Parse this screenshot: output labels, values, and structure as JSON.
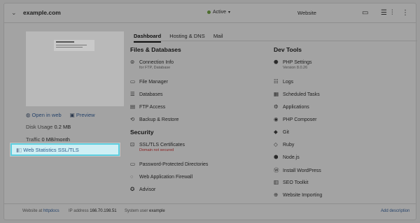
{
  "header": {
    "domain": "example.com",
    "status": "Active",
    "type": "Website"
  },
  "preview": {
    "open_in_web": "Open in web",
    "preview": "Preview",
    "disk_usage_label": "Disk Usage",
    "disk_usage_value": "0.2 MB",
    "traffic_label": "Traffic",
    "traffic_value": "0 MB/month",
    "web_statistics": "Web Statistics SSL/TLS"
  },
  "tabs": [
    "Dashboard",
    "Hosting & DNS",
    "Mail"
  ],
  "files_databases": {
    "title": "Files & Databases",
    "connection_info": "Connection Info",
    "connection_sub": "for FTP, Database",
    "file_manager": "File Manager",
    "databases": "Databases",
    "ftp_access": "FTP Access",
    "backup_restore": "Backup & Restore"
  },
  "security": {
    "title": "Security",
    "ssl": "SSL/TLS Certificates",
    "ssl_sub": "Domain not secured",
    "password_dirs": "Password-Protected Directories",
    "waf": "Web Application Firewall",
    "advisor": "Advisor"
  },
  "dev_tools": {
    "title": "Dev Tools",
    "php_settings": "PHP Settings",
    "php_version": "Version 8.0.26",
    "logs": "Logs",
    "scheduled_tasks": "Scheduled Tasks",
    "applications": "Applications",
    "php_composer": "PHP Composer",
    "git": "Git",
    "ruby": "Ruby",
    "nodejs": "Node.js",
    "install_wordpress": "Install WordPress",
    "seo_toolkit": "SEO Toolkit",
    "website_importing": "Website Importing"
  },
  "footer": {
    "website_at": "Website at",
    "httpdocs": "httpdocs",
    "ip_label": "IP address",
    "ip_value": "166.70.198.51",
    "system_user_label": "System user",
    "system_user_value": "example",
    "add_description": "Add description"
  }
}
